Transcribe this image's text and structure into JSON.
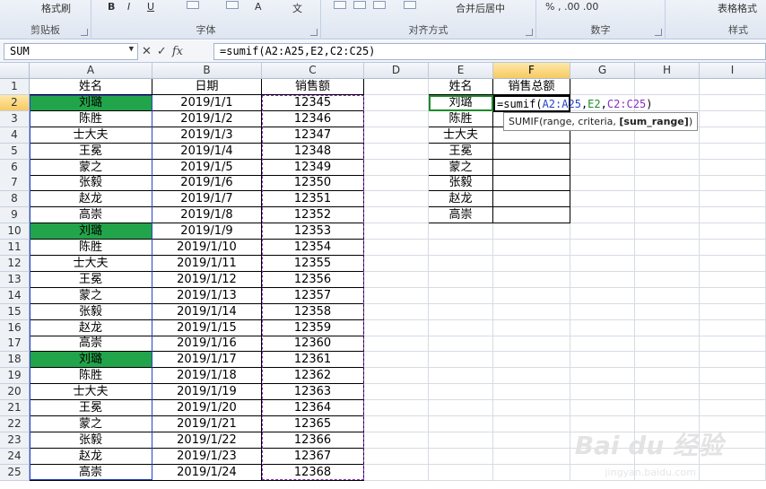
{
  "ribbon": {
    "format_painter_label": "格式刷",
    "table_format_label": "表格格式",
    "groups": [
      "剪贴板",
      "字体",
      "对齐方式",
      "数字",
      "样式"
    ],
    "merge_center_label": "合并后居中",
    "number_format_label": "% ,  .00 .00"
  },
  "formula_bar": {
    "name_box": "SUM",
    "cancel_symbol": "✕",
    "enter_symbol": "✓",
    "fx_symbol": "fx",
    "formula": "=sumif(A2:A25,E2,C2:C25)"
  },
  "columns": [
    "A",
    "B",
    "C",
    "D",
    "E",
    "F",
    "G",
    "H",
    "I"
  ],
  "rows": [
    "1",
    "2",
    "3",
    "4",
    "5",
    "6",
    "7",
    "8",
    "9",
    "10",
    "11",
    "12",
    "13",
    "14",
    "15",
    "16",
    "17",
    "18",
    "19",
    "20",
    "21",
    "22",
    "23",
    "24",
    "25"
  ],
  "table_main": {
    "headers": [
      "姓名",
      "日期",
      "销售额"
    ],
    "rows": [
      [
        "刘璐",
        "2019/1/1",
        "12345"
      ],
      [
        "陈胜",
        "2019/1/2",
        "12346"
      ],
      [
        "士大夫",
        "2019/1/3",
        "12347"
      ],
      [
        "王冕",
        "2019/1/4",
        "12348"
      ],
      [
        "蒙之",
        "2019/1/5",
        "12349"
      ],
      [
        "张毅",
        "2019/1/6",
        "12350"
      ],
      [
        "赵龙",
        "2019/1/7",
        "12351"
      ],
      [
        "高崇",
        "2019/1/8",
        "12352"
      ],
      [
        "刘璐",
        "2019/1/9",
        "12353"
      ],
      [
        "陈胜",
        "2019/1/10",
        "12354"
      ],
      [
        "士大夫",
        "2019/1/11",
        "12355"
      ],
      [
        "王冕",
        "2019/1/12",
        "12356"
      ],
      [
        "蒙之",
        "2019/1/13",
        "12357"
      ],
      [
        "张毅",
        "2019/1/14",
        "12358"
      ],
      [
        "赵龙",
        "2019/1/15",
        "12359"
      ],
      [
        "高崇",
        "2019/1/16",
        "12360"
      ],
      [
        "刘璐",
        "2019/1/17",
        "12361"
      ],
      [
        "陈胜",
        "2019/1/18",
        "12362"
      ],
      [
        "士大夫",
        "2019/1/19",
        "12363"
      ],
      [
        "王冕",
        "2019/1/20",
        "12364"
      ],
      [
        "蒙之",
        "2019/1/21",
        "12365"
      ],
      [
        "张毅",
        "2019/1/22",
        "12366"
      ],
      [
        "赵龙",
        "2019/1/23",
        "12367"
      ],
      [
        "高崇",
        "2019/1/24",
        "12368"
      ]
    ],
    "highlighted_name": "刘璐",
    "highlight_color": "#22a44a"
  },
  "table_summary": {
    "headers": [
      "姓名",
      "销售总额"
    ],
    "names": [
      "刘璐",
      "陈胜",
      "士大夫",
      "王冕",
      "蒙之",
      "张毅",
      "赵龙",
      "高崇"
    ],
    "editing_cell_text": "=sumif(A2:A25,E2,C2:C25)"
  },
  "tooltip": {
    "prefix": "SUMIF(range, criteria, ",
    "bold_arg": "[sum_range]",
    "suffix": ")"
  },
  "colors": {
    "range_blue": "#2244cc",
    "range_green": "#1e8a2e",
    "range_purple": "#8a2bc4",
    "selected_header": "#f7c961"
  },
  "watermark": {
    "logo_text": "Bai du 经验",
    "url_text": "jingyan.baidu.com"
  }
}
